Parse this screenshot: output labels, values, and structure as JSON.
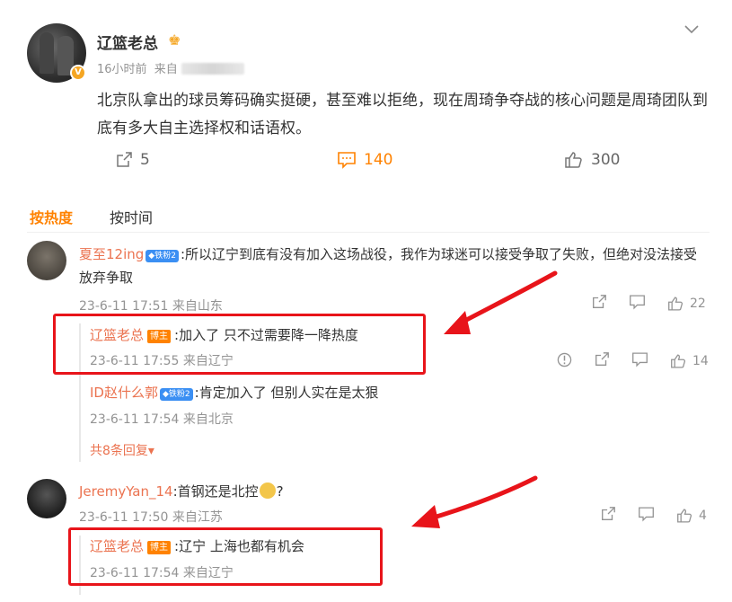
{
  "post": {
    "author": "辽篮老总",
    "time": "16小时前",
    "source_prefix": "来自",
    "text": "北京队拿出的球员筹码确实挺硬，甚至难以拒绝，现在周琦争夺战的核心问题是周琦团队到底有多大自主选择权和话语权。",
    "reposts": "5",
    "comments": "140",
    "likes": "300"
  },
  "tabs": {
    "hot": "按热度",
    "time": "按时间"
  },
  "comments": [
    {
      "user": "夏至12ing",
      "badge": "铁粉2",
      "text": ":所以辽宁到底有没有加入这场战役，我作为球迷可以接受争取了失败，但绝对没法接受放弃争取",
      "meta": "23-6-11 17:51 来自山东",
      "likes": "22",
      "replies": [
        {
          "user": "辽篮老总",
          "badge": "博主",
          "text": ":加入了 只不过需要降一降热度",
          "meta": "23-6-11 17:55 来自辽宁",
          "likes": "14"
        },
        {
          "user": "ID赵什么郭",
          "badge": "铁粉2",
          "text": ":肯定加入了  但别人实在是太狠",
          "meta": "23-6-11 17:54 来自北京"
        }
      ],
      "more": "共8条回复▾"
    },
    {
      "user": "JeremyYan_14",
      "text": ":首钢还是北控",
      "text_tail": "?",
      "meta": "23-6-11 17:50 来自江苏",
      "likes": "4",
      "replies": [
        {
          "user": "辽篮老总",
          "badge": "博主",
          "text": ":辽宁 上海也都有机会",
          "meta": "23-6-11 17:54 来自辽宁"
        }
      ]
    }
  ],
  "colors": {
    "accent": "#ff8200",
    "username": "#eb7350",
    "highlight_box": "#e8141a",
    "arrow": "#e8141a"
  }
}
